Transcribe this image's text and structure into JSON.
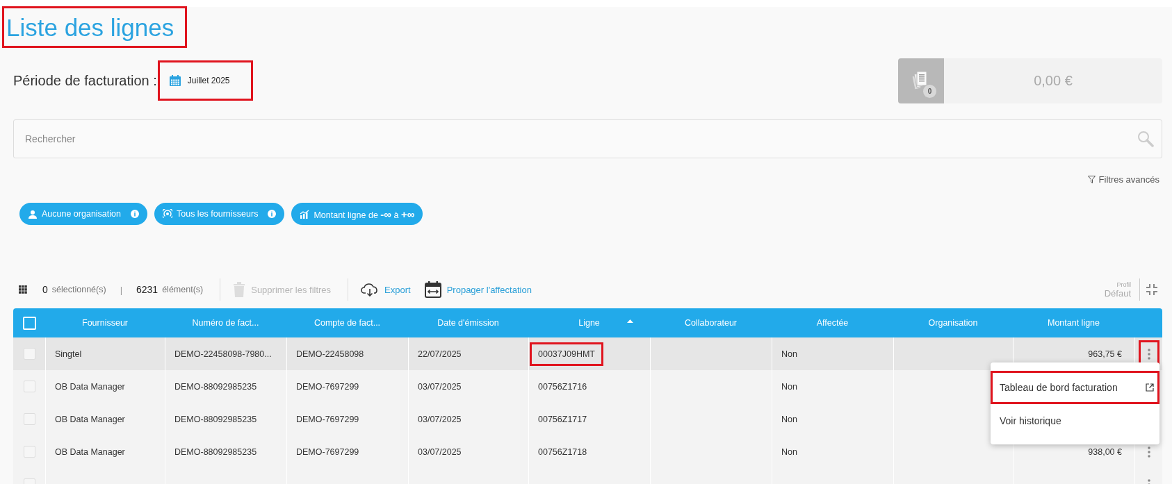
{
  "page": {
    "title": "Liste des lignes",
    "title_highlighted": true
  },
  "period": {
    "label": "Période de facturation :",
    "value": "Juillet 2025",
    "highlighted": true
  },
  "summary": {
    "badge": "0",
    "amount": "0,00 €"
  },
  "search": {
    "placeholder": "Rechercher"
  },
  "advanced_filters": "Filtres avancés",
  "chips": [
    {
      "kind": "organisation",
      "label": "Aucune organisation",
      "info": true
    },
    {
      "kind": "supplier",
      "label": "Tous les fournisseurs",
      "info": true
    },
    {
      "kind": "amount",
      "label": "Montant ligne de **-∞** à **+∞**",
      "info": false
    }
  ],
  "toolbar": {
    "selected_count": "0",
    "selected_label": "sélectionné(s)",
    "separator": "|",
    "total_count": "6231",
    "total_label": "élément(s)",
    "actions": [
      {
        "kind": "delete",
        "label": "Supprimer les filtres",
        "disabled": true
      },
      {
        "kind": "export",
        "label": "Export",
        "disabled": false
      },
      {
        "kind": "propagate",
        "label": "Propager l'affectation",
        "disabled": false
      }
    ],
    "profile_label": "Profil",
    "profile_value": "Défaut"
  },
  "table": {
    "header_checked": false,
    "columns": [
      {
        "label": "Fournisseur",
        "sorted": false
      },
      {
        "label": "Numéro de fact...",
        "sorted": false
      },
      {
        "label": "Compte de fact...",
        "sorted": false
      },
      {
        "label": "Date d'émission",
        "sorted": false
      },
      {
        "label": "Ligne",
        "sorted": true
      },
      {
        "label": "Collaborateur",
        "sorted": false
      },
      {
        "label": "Affectée",
        "sorted": false
      },
      {
        "label": "Organisation",
        "sorted": false
      },
      {
        "label": "Montant ligne",
        "sorted": false
      }
    ],
    "rows": [
      {
        "checked": false,
        "hovered": true,
        "menu_button": {
          "highlighted": true
        },
        "fournisseur": "Singtel",
        "numero": "DEMO-22458098-7980...",
        "compte": "DEMO-22458098",
        "date": "22/07/2025",
        "ligne": {
          "text": "00037J09HMT",
          "highlighted": true
        },
        "affectee": "Non",
        "montant": "963,75 €"
      },
      {
        "checked": false,
        "hovered": false,
        "fournisseur": "OB Data Manager",
        "numero": "DEMO-88092985235",
        "compte": "DEMO-7697299",
        "date": "03/07/2025",
        "ligne": {
          "text": "00756Z1716",
          "highlighted": false
        },
        "affectee": "Non"
      },
      {
        "checked": false,
        "hovered": false,
        "fournisseur": "OB Data Manager",
        "numero": "DEMO-88092985235",
        "compte": "DEMO-7697299",
        "date": "03/07/2025",
        "ligne": {
          "text": "00756Z1717",
          "highlighted": false
        },
        "affectee": "Non"
      },
      {
        "checked": false,
        "hovered": false,
        "menu_button": {
          "highlighted": false
        },
        "fournisseur": "OB Data Manager",
        "numero": "DEMO-88092985235",
        "compte": "DEMO-7697299",
        "date": "03/07/2025",
        "ligne": {
          "text": "00756Z1718",
          "highlighted": false
        },
        "affectee": "Non",
        "montant": "938,00 €"
      },
      {
        "checked": false,
        "hovered": false,
        "menu_button": {
          "highlighted": false
        }
      }
    ]
  },
  "context_menu": {
    "items": [
      {
        "label": "Tableau de bord facturation",
        "external": true,
        "highlighted": true
      },
      {
        "label": "Voir historique",
        "external": false,
        "highlighted": false
      }
    ]
  }
}
